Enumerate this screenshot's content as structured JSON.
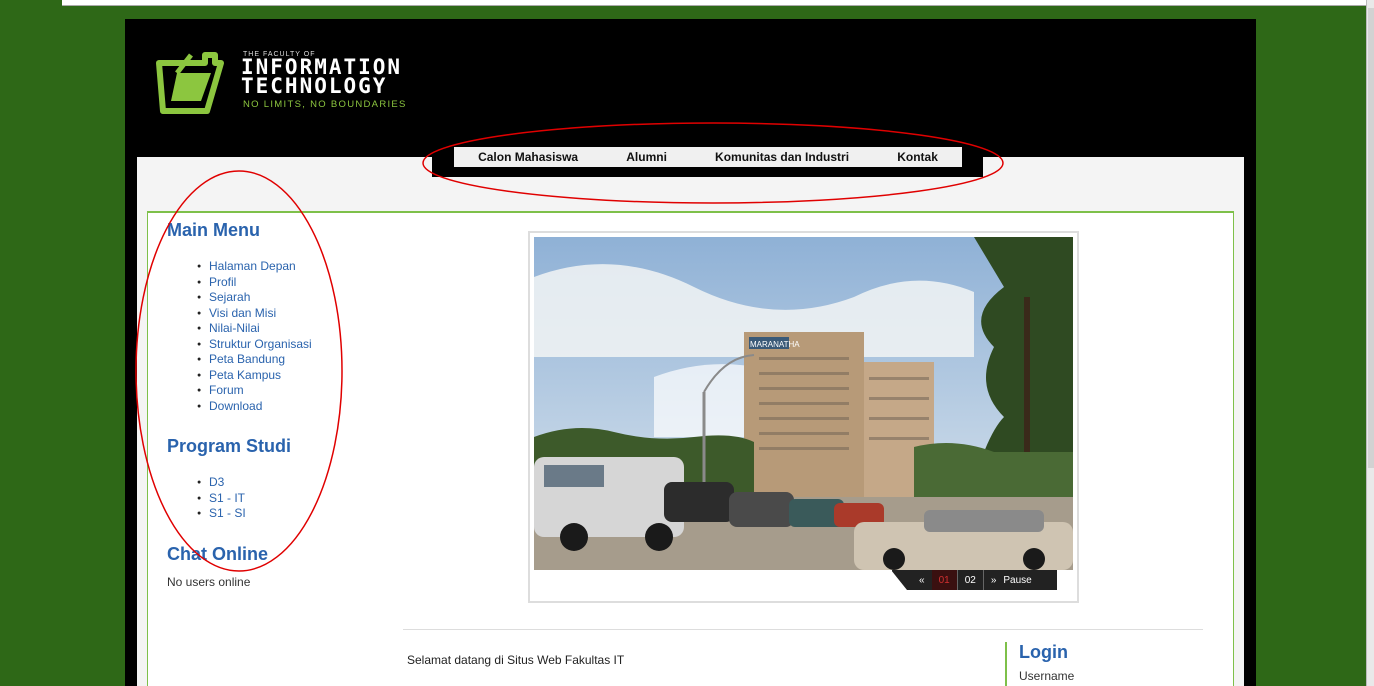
{
  "header": {
    "logo_small": "THE FACULTY OF",
    "logo_line1": "INFORMATION",
    "logo_line2": "TECHNOLOGY",
    "logo_tagline": "NO LIMITS, NO BOUNDARIES"
  },
  "nav": {
    "items": [
      {
        "label": "Calon Mahasiswa"
      },
      {
        "label": "Alumni"
      },
      {
        "label": "Komunitas dan Industri"
      },
      {
        "label": "Kontak"
      }
    ]
  },
  "sidebar": {
    "main_menu": {
      "title": "Main Menu",
      "items": [
        {
          "label": "Halaman Depan"
        },
        {
          "label": "Profil"
        },
        {
          "label": "Sejarah"
        },
        {
          "label": "Visi dan Misi"
        },
        {
          "label": "Nilai-Nilai"
        },
        {
          "label": "Struktur Organisasi"
        },
        {
          "label": "Peta Bandung"
        },
        {
          "label": "Peta Kampus"
        },
        {
          "label": "Forum"
        },
        {
          "label": "Download"
        }
      ]
    },
    "program_studi": {
      "title": "Program Studi",
      "items": [
        {
          "label": "D3"
        },
        {
          "label": "S1 - IT"
        },
        {
          "label": "S1 - SI"
        }
      ]
    },
    "chat": {
      "title": "Chat Online",
      "status": "No users online"
    }
  },
  "slideshow": {
    "prev": "«",
    "slides": [
      "01",
      "02"
    ],
    "active_slide": "01",
    "next": "»",
    "pause": "Pause",
    "building_sign": "MARANATHA"
  },
  "main": {
    "welcome": "Selamat datang di Situs Web Fakultas IT"
  },
  "login": {
    "title": "Login",
    "username_label": "Username"
  },
  "colors": {
    "page_bg": "#2e6817",
    "accent_green": "#8cc63f",
    "link_blue": "#2a63ad",
    "annotation_red": "#e00000"
  }
}
